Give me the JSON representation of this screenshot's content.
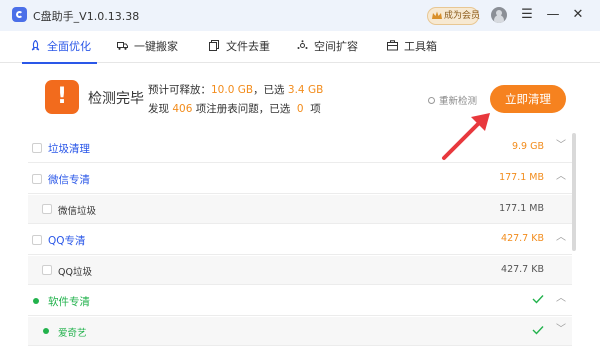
{
  "app": {
    "title": "C盘助手_V1.0.13.38",
    "vip_label": "成为会员"
  },
  "window_controls": {
    "menu": "☰",
    "minimize": "—",
    "close": "✕"
  },
  "tabs": [
    {
      "label": "全面优化",
      "icon": "rocket-icon",
      "active": true
    },
    {
      "label": "一键搬家",
      "icon": "truck-icon",
      "active": false
    },
    {
      "label": "文件去重",
      "icon": "files-icon",
      "active": false
    },
    {
      "label": "空间扩容",
      "icon": "expand-icon",
      "active": false
    },
    {
      "label": "工具箱",
      "icon": "toolbox-icon",
      "active": false
    }
  ],
  "summary": {
    "status": "检测完毕",
    "line1_prefix": "预计可释放：",
    "line1_value": "10.0 GB",
    "line1_mid": "，已选",
    "line1_selected": "3.4 GB",
    "line2_prefix": "发现",
    "line2_count": "406",
    "line2_mid": "项注册表问题，已选",
    "line2_selected": "0",
    "line2_suffix": "项",
    "rescan_label": "重新检测",
    "clean_button": "立即清理"
  },
  "list": [
    {
      "label": "垃圾清理",
      "size": "9.9 GB",
      "chevron": "﹀"
    },
    {
      "label": "微信专清",
      "size": "177.1 MB",
      "chevron": "︿"
    },
    {
      "label": "微信垃圾",
      "size": "177.1 MB"
    },
    {
      "label": "QQ专清",
      "size": "427.7 KB",
      "chevron": "︿"
    },
    {
      "label": "QQ垃圾",
      "size": "427.7 KB"
    },
    {
      "label": "软件专清",
      "chevron": "︿"
    },
    {
      "label": "爱奇艺",
      "chevron": "﹀"
    }
  ],
  "colors": {
    "accent_blue": "#2a57e8",
    "orange": "#f6821f",
    "green": "#22b24c",
    "arrow_red": "#e8383d"
  }
}
